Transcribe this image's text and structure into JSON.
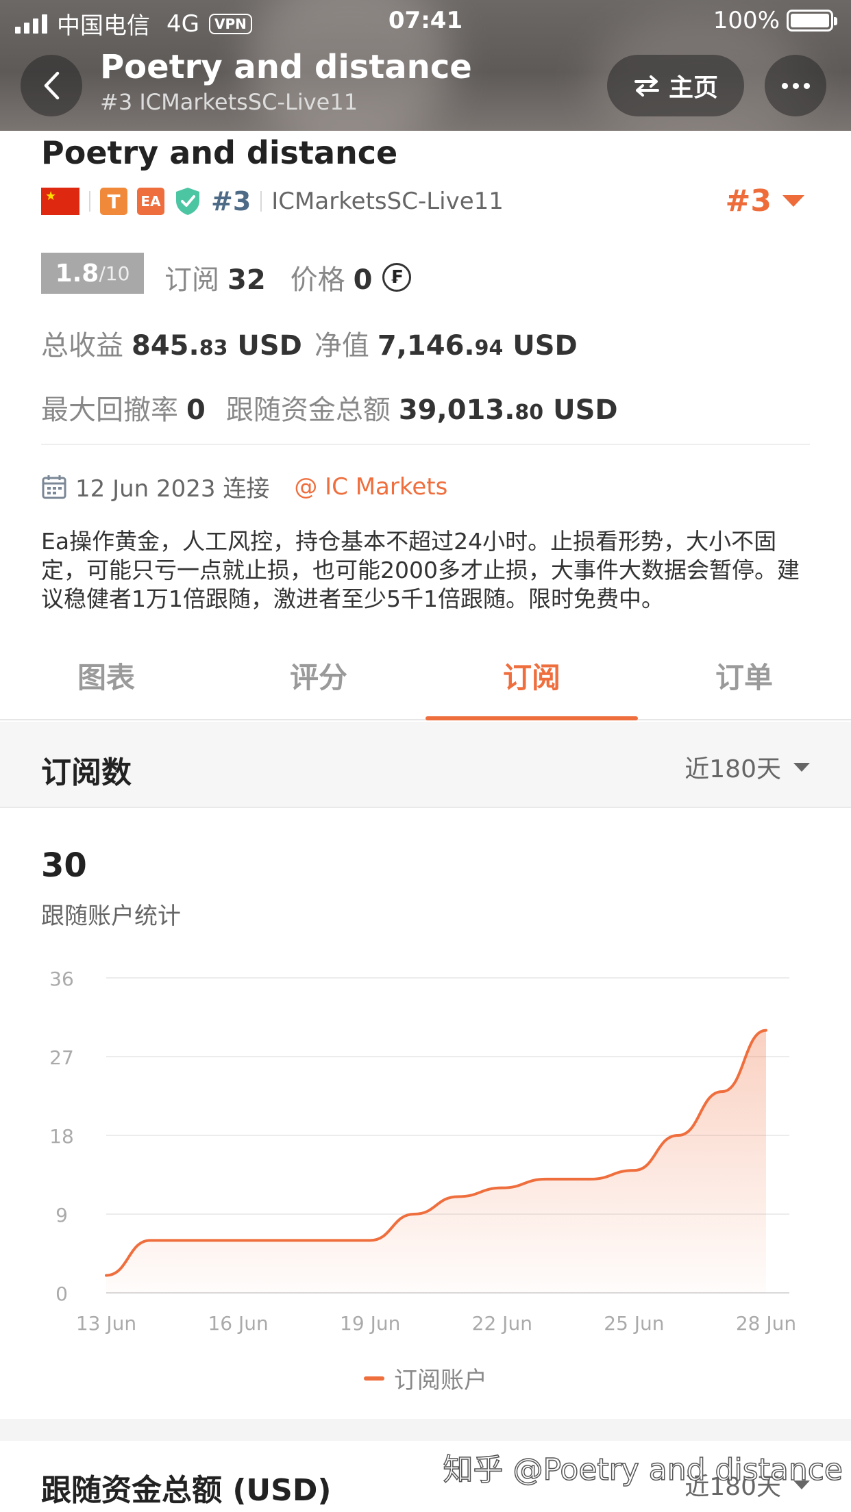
{
  "status_bar": {
    "carrier": "中国电信",
    "network": "4G",
    "vpn": "VPN",
    "time": "07:41",
    "battery": "100%"
  },
  "nav": {
    "title": "Poetry and distance",
    "subtitle": "#3 ICMarketsSC-Live11",
    "home_label": "主页"
  },
  "profile": {
    "name": "Poetry and distance",
    "tag_t": "T",
    "tag_ea": "EA",
    "rank": "#3",
    "server": "ICMarketsSC-Live11",
    "rank_badge": "#3",
    "score": "1.8",
    "score_max": "/10",
    "subscribe_label": "订阅",
    "subscribe_value": "32",
    "price_label": "价格",
    "price_value": "0",
    "coin_symbol": "₣",
    "total_profit_label": "总收益",
    "total_profit_int": "845.",
    "total_profit_dec": "83",
    "total_profit_unit": " USD",
    "equity_label": "净值",
    "equity_int": "7,146.",
    "equity_dec": "94",
    "equity_unit": " USD",
    "drawdown_label": "最大回撤率",
    "drawdown_value": "0",
    "follow_funds_label": "跟随资金总额",
    "follow_funds_int": "39,013.",
    "follow_funds_dec": "80",
    "follow_funds_unit": " USD",
    "connect_date": "12 Jun 2023 连接",
    "broker": "@ IC Markets",
    "description": "Ea操作黄金，人工风控，持仓基本不超过24小时。止损看形势，大小不固定，可能只亏一点就止损，也可能2000多才止损，大事件大数据会暂停。建议稳健者1万1倍跟随，激进者至少5千1倍跟随。限时免费中。"
  },
  "tabs": [
    {
      "label": "图表"
    },
    {
      "label": "评分"
    },
    {
      "label": "订阅",
      "active": true
    },
    {
      "label": "订单"
    }
  ],
  "section": {
    "title": "订阅数",
    "range": "近180天"
  },
  "summary": {
    "value": "30",
    "caption": "跟随账户统计"
  },
  "chart_data": {
    "type": "area",
    "x": [
      "13 Jun",
      "14 Jun",
      "15 Jun",
      "16 Jun",
      "17 Jun",
      "18 Jun",
      "19 Jun",
      "20 Jun",
      "21 Jun",
      "22 Jun",
      "23 Jun",
      "24 Jun",
      "25 Jun",
      "26 Jun",
      "27 Jun",
      "28 Jun"
    ],
    "xticks": [
      "13 Jun",
      "16 Jun",
      "19 Jun",
      "22 Jun",
      "25 Jun",
      "28 Jun"
    ],
    "series": [
      {
        "name": "订阅账户",
        "values": [
          2,
          6,
          6,
          6,
          6,
          6,
          6,
          9,
          11,
          12,
          13,
          13,
          14,
          18,
          23,
          30
        ]
      }
    ],
    "yticks": [
      0,
      9,
      18,
      27,
      36
    ],
    "ylim": [
      0,
      36
    ],
    "grid": true,
    "color": "#ef6e3d"
  },
  "section2": {
    "title": "跟随资金总额 (USD)",
    "range": "近180天"
  },
  "watermark": "知乎 @Poetry and distance"
}
